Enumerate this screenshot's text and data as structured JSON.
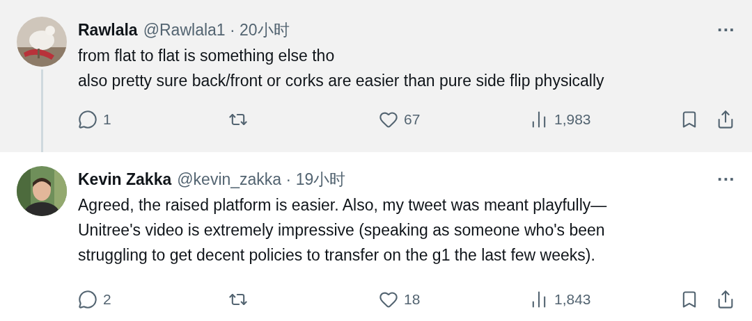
{
  "posts": [
    {
      "name": "Rawlala",
      "handle": "@Rawlala1",
      "separator": "·",
      "time": "20小时",
      "highlighted": true,
      "lines": [
        "from flat to flat is something else tho",
        "also pretty sure back/front or corks are easier than pure side flip physically"
      ],
      "more": "···",
      "replies": "1",
      "likes": "67",
      "views": "1,983"
    },
    {
      "name": "Kevin Zakka",
      "handle": "@kevin_zakka",
      "separator": "·",
      "time": "19小时",
      "highlighted": false,
      "lines": [
        "Agreed, the raised platform is easier. Also, my tweet was meant playfully—",
        "Unitree's video is extremely impressive (speaking as someone who's been",
        "struggling to get decent policies to transfer on the g1 the last few weeks)."
      ],
      "more": "···",
      "replies": "2",
      "likes": "18",
      "views": "1,843"
    }
  ]
}
